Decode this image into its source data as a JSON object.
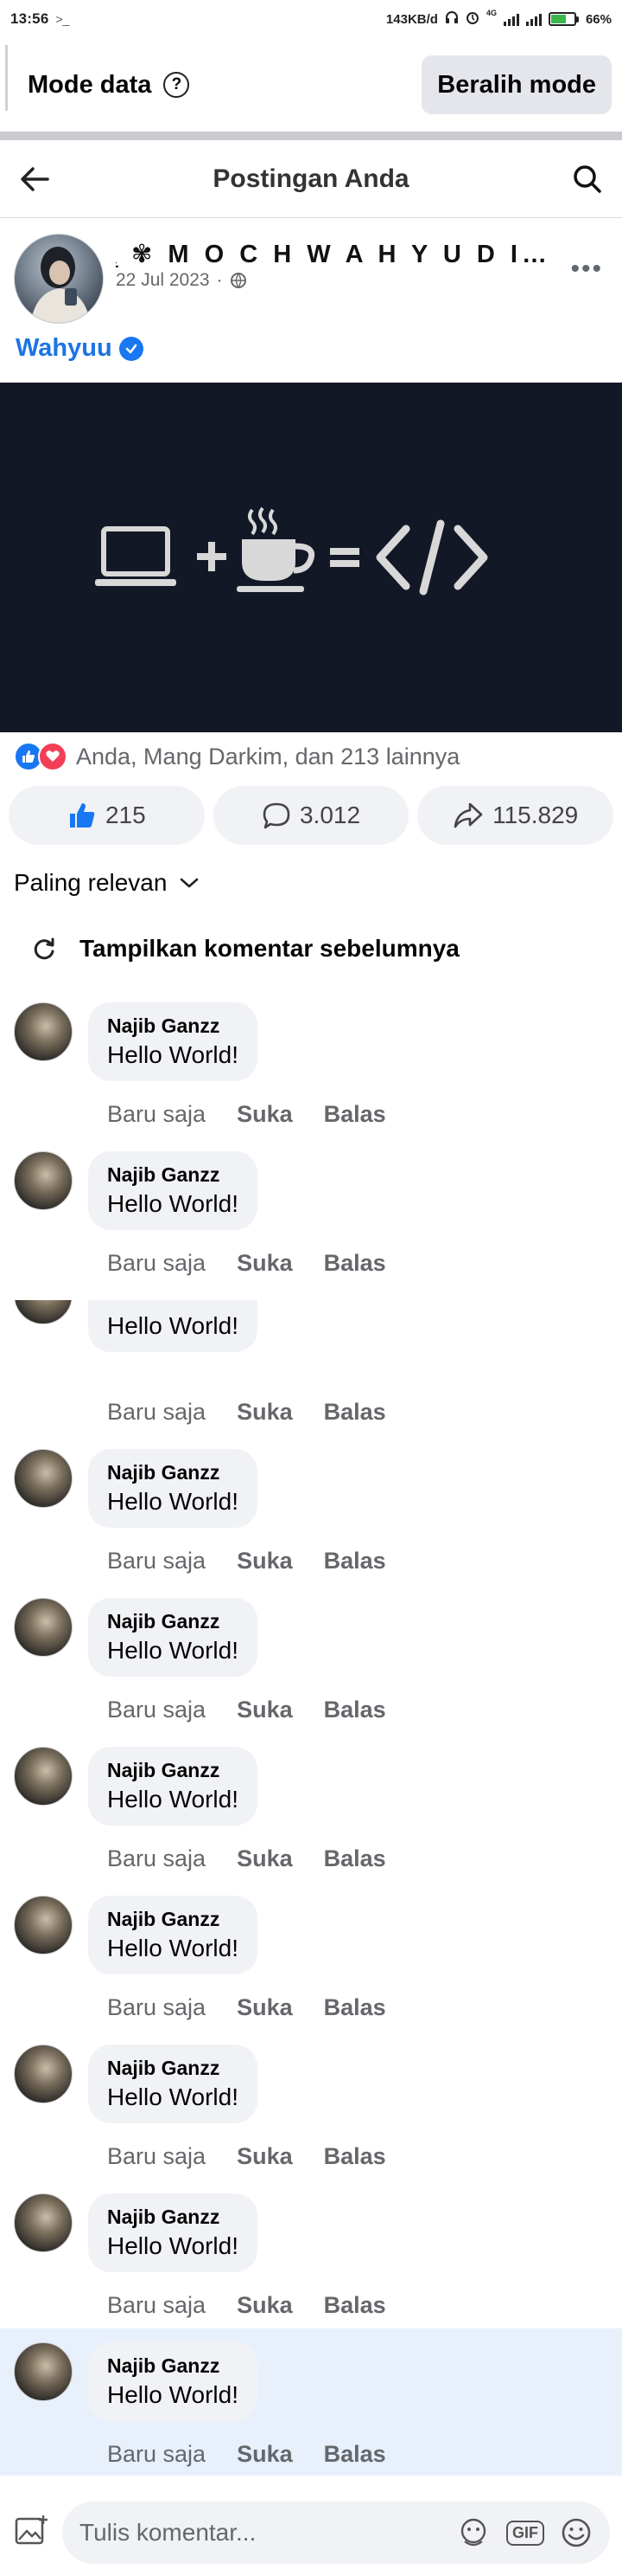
{
  "status_bar": {
    "time": "13:56",
    "caret": ">_",
    "network_speed": "143KB/d",
    "network_type": "4G",
    "battery_percent": "66%",
    "battery_level": 0.66
  },
  "data_mode": {
    "label": "Mode data",
    "help_icon": "?",
    "switch_button": "Beralih mode"
  },
  "header": {
    "title": "Postingan Anda",
    "back_icon": "arrow-left-icon",
    "search_icon": "search-icon"
  },
  "post": {
    "author_name": "̨ ✾ M O C H W A H Y U D I N A...",
    "date": "22 Jul 2023",
    "caption": "Wahyuu",
    "image_icons": [
      "laptop-icon",
      "coffee-icon",
      "code-icon"
    ],
    "reactions_text": "Anda, Mang Darkim, dan 213 lainnya",
    "like_count": "215",
    "comment_count": "3.012",
    "share_count": "115.829"
  },
  "comments_section": {
    "sort_label": "Paling relevan",
    "previous_label": "Tampilkan komentar sebelumnya"
  },
  "comments": [
    {
      "name": "Najib Ganzz",
      "text": "Hello World!",
      "time": "Baru saja",
      "like": "Suka",
      "reply": "Balas"
    },
    {
      "name": "Najib Ganzz",
      "text": "Hello World!",
      "time": "Baru saja",
      "like": "Suka",
      "reply": "Balas"
    },
    {
      "name": "",
      "text": "Hello World!",
      "time": "Baru saja",
      "like": "Suka",
      "reply": "Balas"
    },
    {
      "name": "Najib Ganzz",
      "text": "Hello World!",
      "time": "Baru saja",
      "like": "Suka",
      "reply": "Balas"
    },
    {
      "name": "Najib Ganzz",
      "text": "Hello World!",
      "time": "Baru saja",
      "like": "Suka",
      "reply": "Balas"
    },
    {
      "name": "Najib Ganzz",
      "text": "Hello World!",
      "time": "Baru saja",
      "like": "Suka",
      "reply": "Balas"
    },
    {
      "name": "Najib Ganzz",
      "text": "Hello World!",
      "time": "Baru saja",
      "like": "Suka",
      "reply": "Balas"
    },
    {
      "name": "Najib Ganzz",
      "text": "Hello World!",
      "time": "Baru saja",
      "like": "Suka",
      "reply": "Balas"
    },
    {
      "name": "Najib Ganzz",
      "text": "Hello World!",
      "time": "Baru saja",
      "like": "Suka",
      "reply": "Balas"
    },
    {
      "name": "Najib Ganzz",
      "text": "Hello World!",
      "time": "Baru saja",
      "like": "Suka",
      "reply": "Balas"
    }
  ],
  "composer": {
    "placeholder": "Tulis komentar...",
    "gif_label": "GIF"
  },
  "colors": {
    "accent": "#1877f2",
    "image_bg": "#121826",
    "highlight": "#e7f0fb"
  }
}
